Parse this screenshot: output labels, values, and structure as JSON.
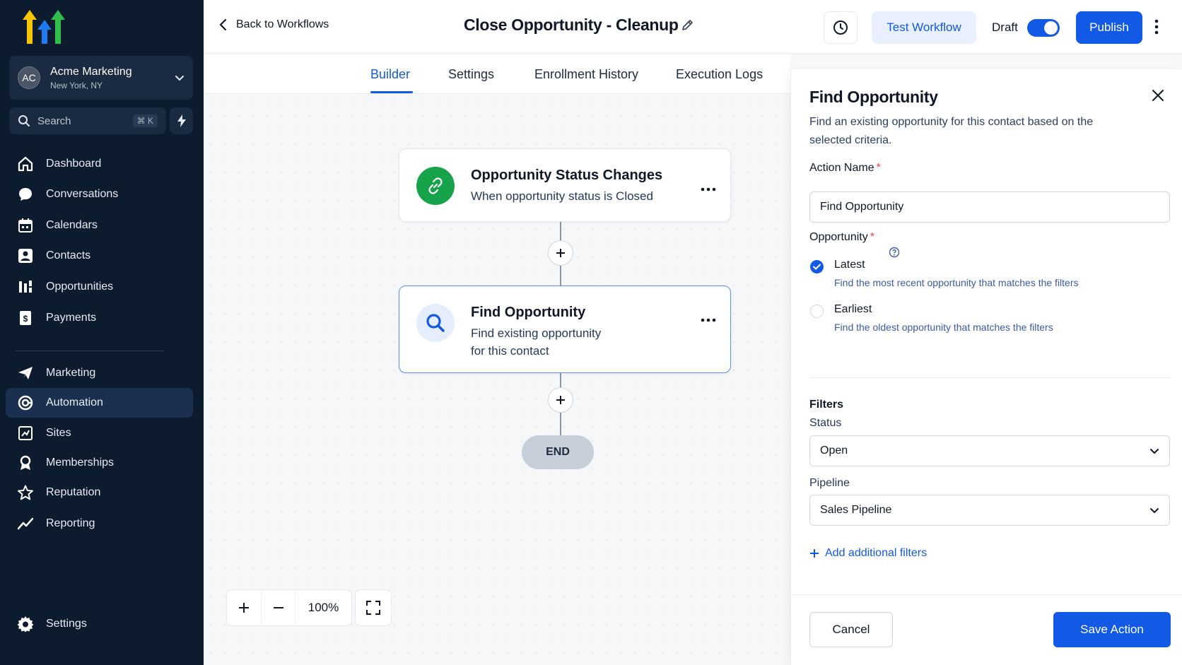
{
  "sidebar": {
    "account": {
      "initials": "AC",
      "name": "Acme Marketing",
      "location": "New York, NY"
    },
    "search": {
      "label": "Search",
      "shortcut": "⌘ K"
    },
    "items": [
      {
        "label": "Dashboard",
        "icon": "home-icon"
      },
      {
        "label": "Conversations",
        "icon": "chat-icon"
      },
      {
        "label": "Calendars",
        "icon": "calendar-icon"
      },
      {
        "label": "Contacts",
        "icon": "contacts-icon"
      },
      {
        "label": "Opportunities",
        "icon": "opportunities-icon"
      },
      {
        "label": "Payments",
        "icon": "payments-icon"
      },
      {
        "label": "Marketing",
        "icon": "send-icon"
      },
      {
        "label": "Automation",
        "icon": "automation-icon",
        "active": true
      },
      {
        "label": "Sites",
        "icon": "sites-icon"
      },
      {
        "label": "Memberships",
        "icon": "membership-icon"
      },
      {
        "label": "Reputation",
        "icon": "star-icon"
      },
      {
        "label": "Reporting",
        "icon": "chart-icon"
      }
    ],
    "settings_label": "Settings"
  },
  "topbar": {
    "back_label": "Back to Workflows",
    "workflow_title": "Close Opportunity - Cleanup",
    "test_label": "Test Workflow",
    "draft_label": "Draft",
    "publish_label": "Publish"
  },
  "tabs": [
    {
      "label": "Builder",
      "active": true
    },
    {
      "label": "Settings"
    },
    {
      "label": "Enrollment History"
    },
    {
      "label": "Execution Logs"
    }
  ],
  "canvas": {
    "trigger": {
      "title": "Opportunity Status Changes",
      "subtitle": "When opportunity status is Closed"
    },
    "action": {
      "title": "Find Opportunity",
      "subtitle_line1": "Find existing opportunity",
      "subtitle_line2": "for this contact"
    },
    "end_label": "END",
    "zoom": "100%"
  },
  "panel": {
    "title": "Find Opportunity",
    "description": "Find an existing opportunity for this contact based on the selected criteria.",
    "action_name_label": "Action Name",
    "action_name_value": "Find Opportunity",
    "opportunity_label": "Opportunity",
    "options": [
      {
        "title": "Latest",
        "desc": "Find the most recent opportunity that matches the filters",
        "selected": true
      },
      {
        "title": "Earliest",
        "desc": "Find the oldest opportunity that matches the filters",
        "selected": false
      }
    ],
    "filters_heading": "Filters",
    "status_label": "Status",
    "status_value": "Open",
    "pipeline_label": "Pipeline",
    "pipeline_value": "Sales Pipeline",
    "add_filters_label": "Add additional filters",
    "cancel_label": "Cancel",
    "save_label": "Save Action"
  },
  "colors": {
    "primary": "#1259e6",
    "sidebar_bg": "#0d1b2e",
    "trigger_green": "#16a34a"
  }
}
